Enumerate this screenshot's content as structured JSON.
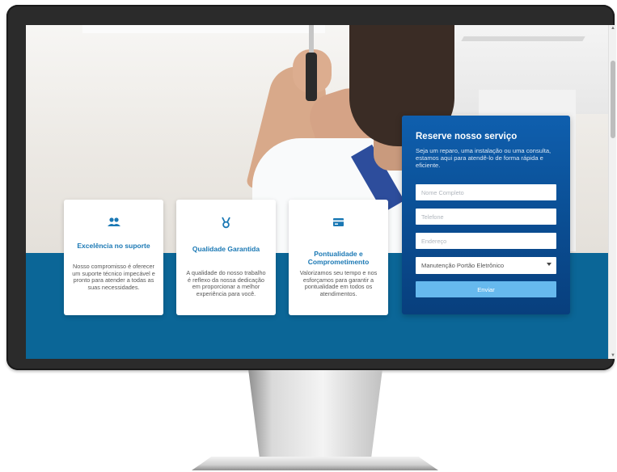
{
  "cards": [
    {
      "icon": "users-icon",
      "title": "Excelência no suporte",
      "text": "Nosso compromisso é oferecer um suporte técnico impecável e pronto para atender a todas as suas necessidades."
    },
    {
      "icon": "award-ribbon-icon",
      "title": "Qualidade Garantida",
      "text": "A qualidade do nosso trabalho é reflexo da nossa dedicação em proporcionar a melhor experiência para você."
    },
    {
      "icon": "credit-card-icon",
      "title": "Pontualidade e Comprometimento",
      "text": "Valorizamos seu tempo e nos esforçamos para garantir a pontualidade em todos os atendimentos."
    }
  ],
  "form": {
    "title": "Reserve nosso serviço",
    "description": "Seja um reparo, uma instalação ou uma consulta, estamos aqui para atendê-lo de forma rápida e eficiente.",
    "name_placeholder": "Nome Completo",
    "phone_placeholder": "Telefone",
    "address_placeholder": "Endereço",
    "service_selected": "Manutenção Portão Eletrônico",
    "submit_label": "Enviar"
  },
  "colors": {
    "band": "#0b6697",
    "card_title": "#1a78b4",
    "form_bg": "#0a4d92",
    "submit_bg": "#66b9ee"
  }
}
